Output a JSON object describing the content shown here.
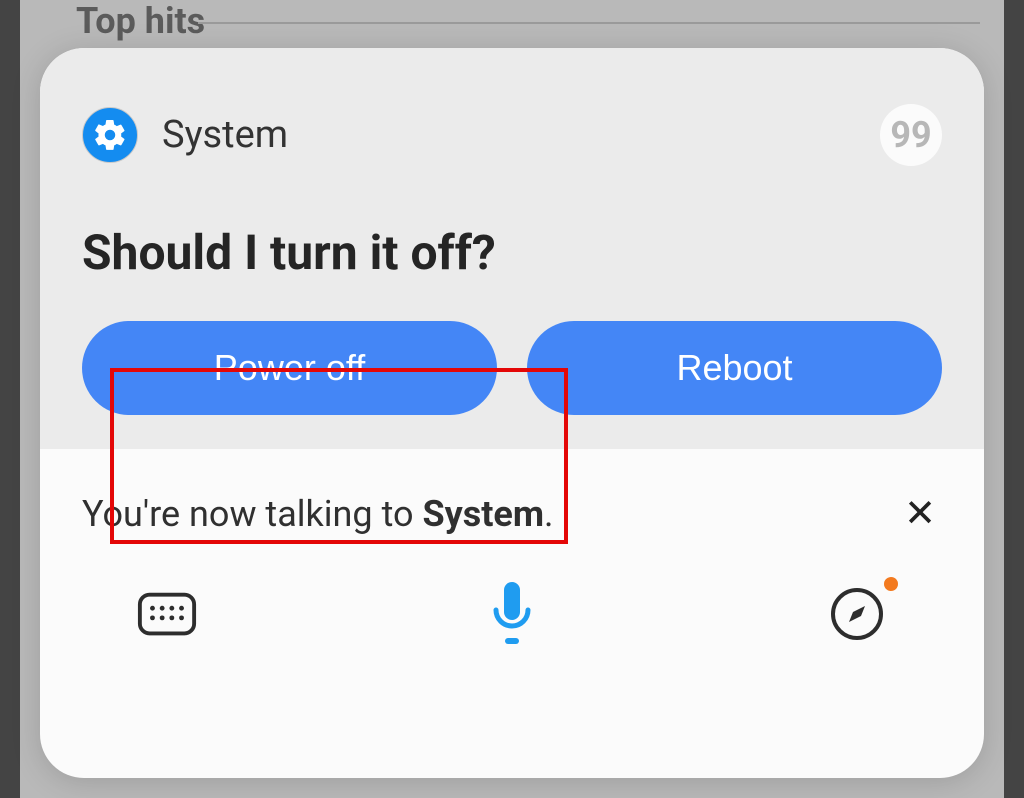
{
  "background": {
    "section_title": "Top hits"
  },
  "dialog": {
    "source_label": "System",
    "quote_glyph": "99",
    "prompt": "Should I turn it off?",
    "buttons": {
      "power_off": "Power off",
      "reboot": "Reboot"
    }
  },
  "status": {
    "prefix": "You're now talking to ",
    "target": "System",
    "suffix": "."
  },
  "icons": {
    "gear": "settings-gear",
    "quote": "quote",
    "close": "✕",
    "keyboard": "keyboard",
    "mic": "microphone",
    "compass": "discover-compass"
  },
  "colors": {
    "accent_blue": "#4486f6",
    "icon_blue": "#1f9cf0",
    "highlight_red": "#e40707",
    "notif_orange": "#f37a1f"
  }
}
